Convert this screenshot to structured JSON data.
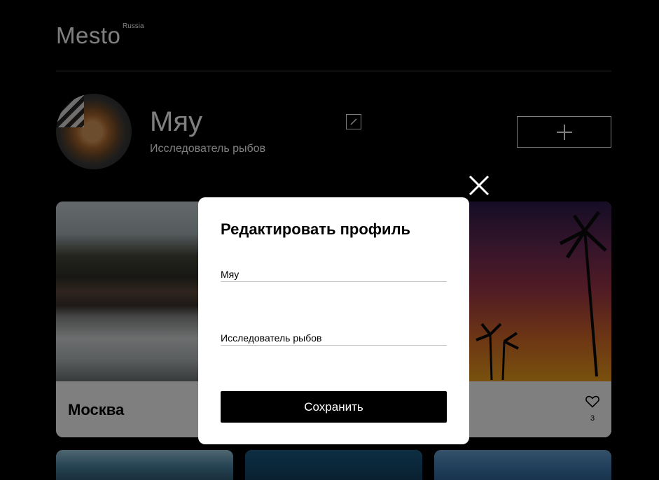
{
  "header": {
    "logo": "Mesto",
    "logo_sub": "Russia"
  },
  "profile": {
    "name": "Мяу",
    "about": "Исследователь рыбов",
    "avatar_icon": "cat-photo"
  },
  "cards": [
    {
      "title": "Москва",
      "likes": ""
    },
    {
      "title": "",
      "likes": "3"
    }
  ],
  "popup": {
    "title": "Редактировать профиль",
    "name_value": "Мяу",
    "about_value": "Исследователь рыбов",
    "save_label": "Сохранить"
  },
  "icons": {
    "edit": "pencil-icon",
    "add": "plus-icon",
    "close": "close-icon",
    "like": "heart-icon"
  }
}
